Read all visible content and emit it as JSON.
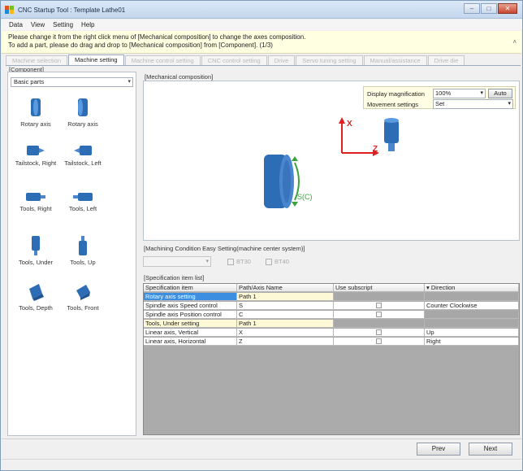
{
  "window": {
    "title": "CNC Startup Tool : Template Lathe01",
    "controls": [
      "minimize-icon",
      "maximize-icon",
      "close-icon"
    ]
  },
  "menu": [
    "Data",
    "View",
    "Setting",
    "Help"
  ],
  "notice": {
    "line1": "Please change it from the right click menu of [Mechanical composition] to change the axes composition.",
    "line2": "To add a part, please do drag and drop to [Mechanical composition] from [Component]. (1/3)",
    "toggle": "˄"
  },
  "tabs": [
    "Machine selection",
    "Machine setting",
    "Machine control setting",
    "CNC control setting",
    "Drive",
    "Servo tuning setting",
    "Manual/assistance",
    "Drive die"
  ],
  "component": {
    "label": "[Component]",
    "category": "Basic parts",
    "parts": [
      "Rotary axis",
      "Rotary axis",
      "Tailstock, Right",
      "Tailstock, Left",
      "Tools, Right",
      "Tools, Left",
      "Tools, Under",
      "Tools, Up",
      "Tools, Depth",
      "Tools, Front"
    ]
  },
  "mechanical": {
    "label": "[Mechanical composition]",
    "display_mag_label": "Display magnification",
    "display_mag_value": "100%",
    "auto_label": "Auto",
    "movement_label": "Movement settings",
    "movement_value": "Set",
    "axis_x": "X",
    "axis_z": "Z",
    "spindle_label": "S(C)"
  },
  "machining": {
    "label": "[Machining Condition Easy Setting(machine center system)]",
    "select_value": "",
    "options": [
      "BT30",
      "BT40"
    ]
  },
  "spec": {
    "label": "[Specification item list]",
    "headers": [
      "Specification item",
      "Path/Axis Name",
      "Use subscript",
      "Direction"
    ],
    "rows": [
      {
        "item": "Rotary axis setting",
        "path": "Path 1",
        "type": "group-selected"
      },
      {
        "item": "Spindle axis   Speed control",
        "path": "S",
        "subscript": true,
        "direction": "Counter Clockwise",
        "type": "row"
      },
      {
        "item": "Spindle axis   Position control",
        "path": "C",
        "subscript": true,
        "direction": "",
        "type": "row-gray"
      },
      {
        "item": "Tools, Under setting",
        "path": "Path 1",
        "type": "group"
      },
      {
        "item": "Linear axis, Vertical",
        "path": "X",
        "subscript": true,
        "direction": "Up",
        "type": "row"
      },
      {
        "item": "Linear axis, Horizontal",
        "path": "Z",
        "subscript": true,
        "direction": "Right",
        "type": "row"
      }
    ]
  },
  "buttons": {
    "prev": "Prev",
    "next": "Next"
  },
  "colors": {
    "part_blue": "#2d6db5",
    "axis_red": "#e02020",
    "spindle_green": "#3aa33a",
    "selection": "#3b8ee0",
    "notice_bg": "#ffffe1"
  }
}
